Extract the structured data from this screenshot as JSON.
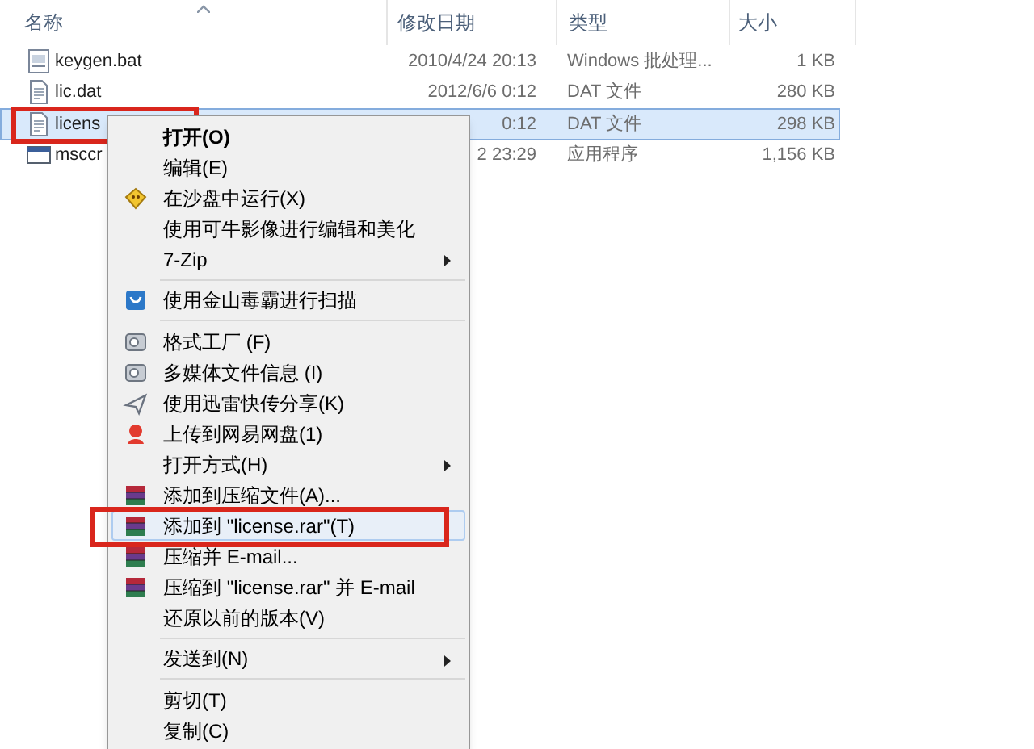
{
  "columns": [
    {
      "label": "名称"
    },
    {
      "label": "修改日期"
    },
    {
      "label": "类型"
    },
    {
      "label": "大小"
    }
  ],
  "files": [
    {
      "name": "keygen.bat",
      "modified": "2010/4/24 20:13",
      "type": "Windows 批处理...",
      "size": "1 KB",
      "kind": "batch",
      "selected": false,
      "highlighted": false
    },
    {
      "name": "lic.dat",
      "modified": "2012/6/6 0:12",
      "type": "DAT 文件",
      "size": "280 KB",
      "kind": "document",
      "selected": false,
      "highlighted": false
    },
    {
      "name": "licens",
      "modified": "0:12",
      "type": "DAT 文件",
      "size": "298 KB",
      "kind": "document",
      "selected": true,
      "highlighted": true
    },
    {
      "name": "msccr",
      "modified": "2 23:29",
      "type": "应用程序",
      "size": "1,156 KB",
      "kind": "program",
      "selected": false,
      "highlighted": false
    }
  ],
  "context_menu": [
    {
      "kind": "item",
      "label": "打开(O)",
      "default": true,
      "selected": false,
      "highlighted": false
    },
    {
      "kind": "item",
      "label": "编辑(E)",
      "selected": false,
      "highlighted": false
    },
    {
      "kind": "item",
      "label": "在沙盘中运行(X)",
      "selected": false,
      "highlighted": false
    },
    {
      "kind": "item",
      "label": "使用可牛影像进行编辑和美化",
      "selected": false,
      "highlighted": false
    },
    {
      "kind": "item",
      "label": "7-Zip",
      "submenu": true,
      "selected": false,
      "highlighted": false
    },
    {
      "kind": "separator"
    },
    {
      "kind": "item",
      "label": "使用金山毒霸进行扫描",
      "selected": false,
      "highlighted": false
    },
    {
      "kind": "separator"
    },
    {
      "kind": "item",
      "label": "格式工厂 (F)",
      "selected": false,
      "highlighted": false
    },
    {
      "kind": "item",
      "label": "多媒体文件信息 (I)",
      "selected": false,
      "highlighted": false
    },
    {
      "kind": "item",
      "label": "使用迅雷快传分享(K)",
      "selected": false,
      "highlighted": false
    },
    {
      "kind": "item",
      "label": "上传到网易网盘(1)",
      "selected": false,
      "highlighted": false
    },
    {
      "kind": "item",
      "label": "打开方式(H)",
      "submenu": true,
      "selected": false,
      "highlighted": false
    },
    {
      "kind": "item",
      "label": "添加到压缩文件(A)...",
      "selected": false,
      "highlighted": false
    },
    {
      "kind": "item",
      "label": "添加到 \"license.rar\"(T)",
      "selected": true,
      "highlighted": true
    },
    {
      "kind": "item",
      "label": "压缩并 E-mail...",
      "selected": false,
      "highlighted": false
    },
    {
      "kind": "item",
      "label": "压缩到 \"license.rar\" 并 E-mail",
      "selected": false,
      "highlighted": false
    },
    {
      "kind": "item",
      "label": "还原以前的版本(V)",
      "selected": false,
      "highlighted": false
    },
    {
      "kind": "separator"
    },
    {
      "kind": "item",
      "label": "发送到(N)",
      "submenu": true,
      "selected": false,
      "highlighted": false
    },
    {
      "kind": "separator"
    },
    {
      "kind": "item",
      "label": "剪切(T)",
      "selected": false,
      "highlighted": false
    },
    {
      "kind": "item",
      "label": "复制(C)",
      "selected": false,
      "highlighted": false
    }
  ]
}
